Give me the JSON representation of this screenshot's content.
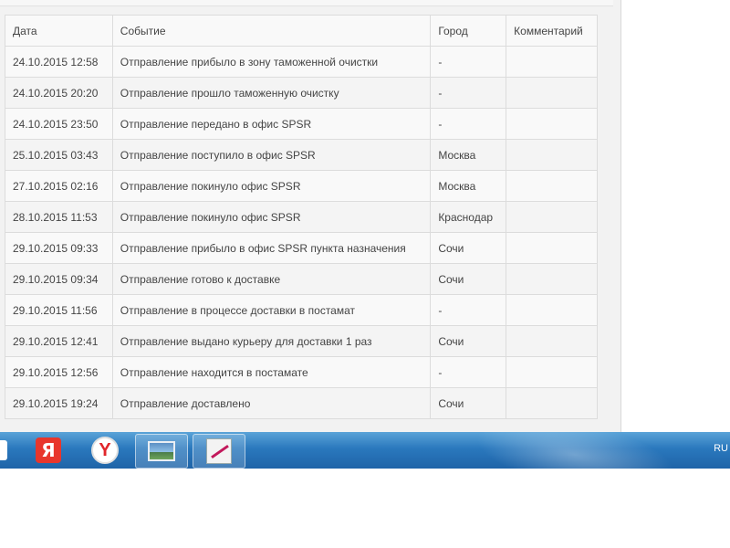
{
  "table": {
    "headers": [
      "Дата",
      "Событие",
      "Город",
      "Комментарий"
    ],
    "rows": [
      [
        "24.10.2015 12:58",
        "Отправление прибыло в зону таможенной очистки",
        "-",
        ""
      ],
      [
        "24.10.2015 20:20",
        "Отправление прошло таможенную очистку",
        "-",
        ""
      ],
      [
        "24.10.2015 23:50",
        "Отправление передано в офис SPSR",
        "-",
        ""
      ],
      [
        "25.10.2015 03:43",
        "Отправление поступило в офис SPSR",
        "Москва",
        ""
      ],
      [
        "27.10.2015 02:16",
        "Отправление покинуло офис SPSR",
        "Москва",
        ""
      ],
      [
        "28.10.2015 11:53",
        "Отправление покинуло офис SPSR",
        "Краснодар",
        ""
      ],
      [
        "29.10.2015 09:33",
        "Отправление прибыло в офис SPSR пункта назначения",
        "Сочи",
        ""
      ],
      [
        "29.10.2015 09:34",
        "Отправление готово к доставке",
        "Сочи",
        ""
      ],
      [
        "29.10.2015 11:56",
        "Отправление в процессе доставки в постамат",
        "-",
        ""
      ],
      [
        "29.10.2015 12:41",
        "Отправление выдано курьеру для доставки 1 раз",
        "Сочи",
        ""
      ],
      [
        "29.10.2015 12:56",
        "Отправление находится в постамате",
        "-",
        ""
      ],
      [
        "29.10.2015 19:24",
        "Отправление доставлено",
        "Сочи",
        ""
      ]
    ]
  },
  "taskbar": {
    "yandex_browser_glyph": "Я",
    "yandex_glyph": "Y",
    "language": "RU",
    "icons": [
      "start-button-icon",
      "yandex-browser-icon",
      "yandex-icon",
      "photo-viewer-icon",
      "paint-icon"
    ]
  }
}
